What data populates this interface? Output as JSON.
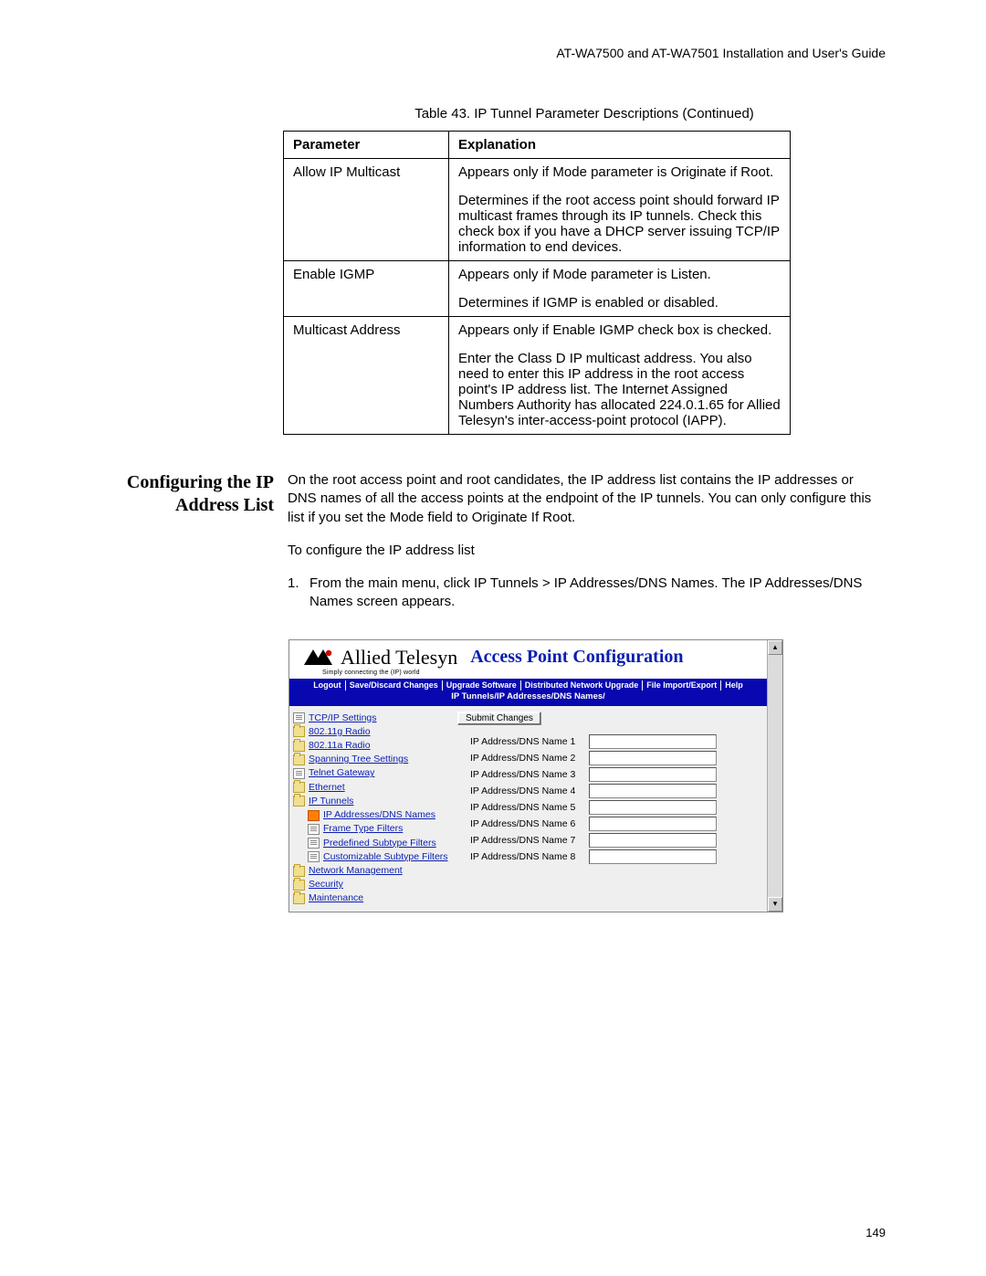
{
  "header": "AT-WA7500 and AT-WA7501 Installation and User's Guide",
  "tableCaption": "Table 43. IP Tunnel Parameter Descriptions (Continued)",
  "tableHeaders": {
    "param": "Parameter",
    "expl": "Explanation"
  },
  "rows": [
    {
      "param": "Allow IP Multicast",
      "expl": [
        "Appears only if Mode parameter is Originate if Root.",
        "Determines if the root access point should forward IP multicast frames through its IP tunnels. Check this check box if you have a DHCP server issuing TCP/IP information to end devices."
      ]
    },
    {
      "param": "Enable IGMP",
      "expl": [
        "Appears only if Mode parameter is Listen.",
        "Determines if IGMP is enabled or disabled."
      ]
    },
    {
      "param": "Multicast Address",
      "expl": [
        "Appears only if Enable IGMP check box is checked.",
        "Enter the Class D IP multicast address. You also need to enter this IP address in the root access point's IP address list. The Internet Assigned Numbers Authority has allocated 224.0.1.65 for Allied Telesyn's inter-access-point protocol (IAPP)."
      ]
    }
  ],
  "sectionHeading": "Configuring the IP Address List",
  "sectionPara1": "On the root access point and root candidates, the IP address list contains the IP addresses or DNS names of all the access points at the endpoint of the IP tunnels. You can only configure this list if you set the Mode field to Originate If Root.",
  "sectionPara2": "To configure the IP address list",
  "step1": "From the main menu, click IP Tunnels > IP Addresses/DNS Names. The IP Addresses/DNS Names screen appears.",
  "app": {
    "brand": "Allied Telesyn",
    "tagline": "Simply connecting the (IP) world",
    "title": "Access Point Configuration",
    "menu": [
      "Logout",
      "Save/Discard Changes",
      "Upgrade Software",
      "Distributed Network Upgrade",
      "File Import/Export",
      "Help"
    ],
    "breadcrumb": "IP Tunnels/IP Addresses/DNS Names/",
    "nav": [
      {
        "icon": "doc",
        "label": "TCP/IP Settings",
        "indent": 0
      },
      {
        "icon": "folder",
        "label": "802.11g Radio",
        "indent": 0
      },
      {
        "icon": "folder",
        "label": "802.11a Radio",
        "indent": 0
      },
      {
        "icon": "folder",
        "label": "Spanning Tree Settings",
        "indent": 0
      },
      {
        "icon": "doc",
        "label": "Telnet Gateway",
        "indent": 0
      },
      {
        "icon": "folder",
        "label": "Ethernet",
        "indent": 0
      },
      {
        "icon": "folder",
        "label": "IP Tunnels",
        "indent": 0
      },
      {
        "icon": "orange",
        "label": "IP Addresses/DNS Names",
        "indent": 1
      },
      {
        "icon": "doc",
        "label": "Frame Type Filters",
        "indent": 1
      },
      {
        "icon": "doc",
        "label": "Predefined Subtype Filters",
        "indent": 1
      },
      {
        "icon": "doc",
        "label": "Customizable Subtype Filters",
        "indent": 1
      },
      {
        "icon": "folder",
        "label": "Network Management",
        "indent": 0
      },
      {
        "icon": "folder",
        "label": "Security",
        "indent": 0
      },
      {
        "icon": "folder",
        "label": "Maintenance",
        "indent": 0
      }
    ],
    "submit": "Submit Changes",
    "fields": [
      "IP Address/DNS Name 1",
      "IP Address/DNS Name 2",
      "IP Address/DNS Name 3",
      "IP Address/DNS Name 4",
      "IP Address/DNS Name 5",
      "IP Address/DNS Name 6",
      "IP Address/DNS Name 7",
      "IP Address/DNS Name 8"
    ]
  },
  "pageNumber": "149"
}
